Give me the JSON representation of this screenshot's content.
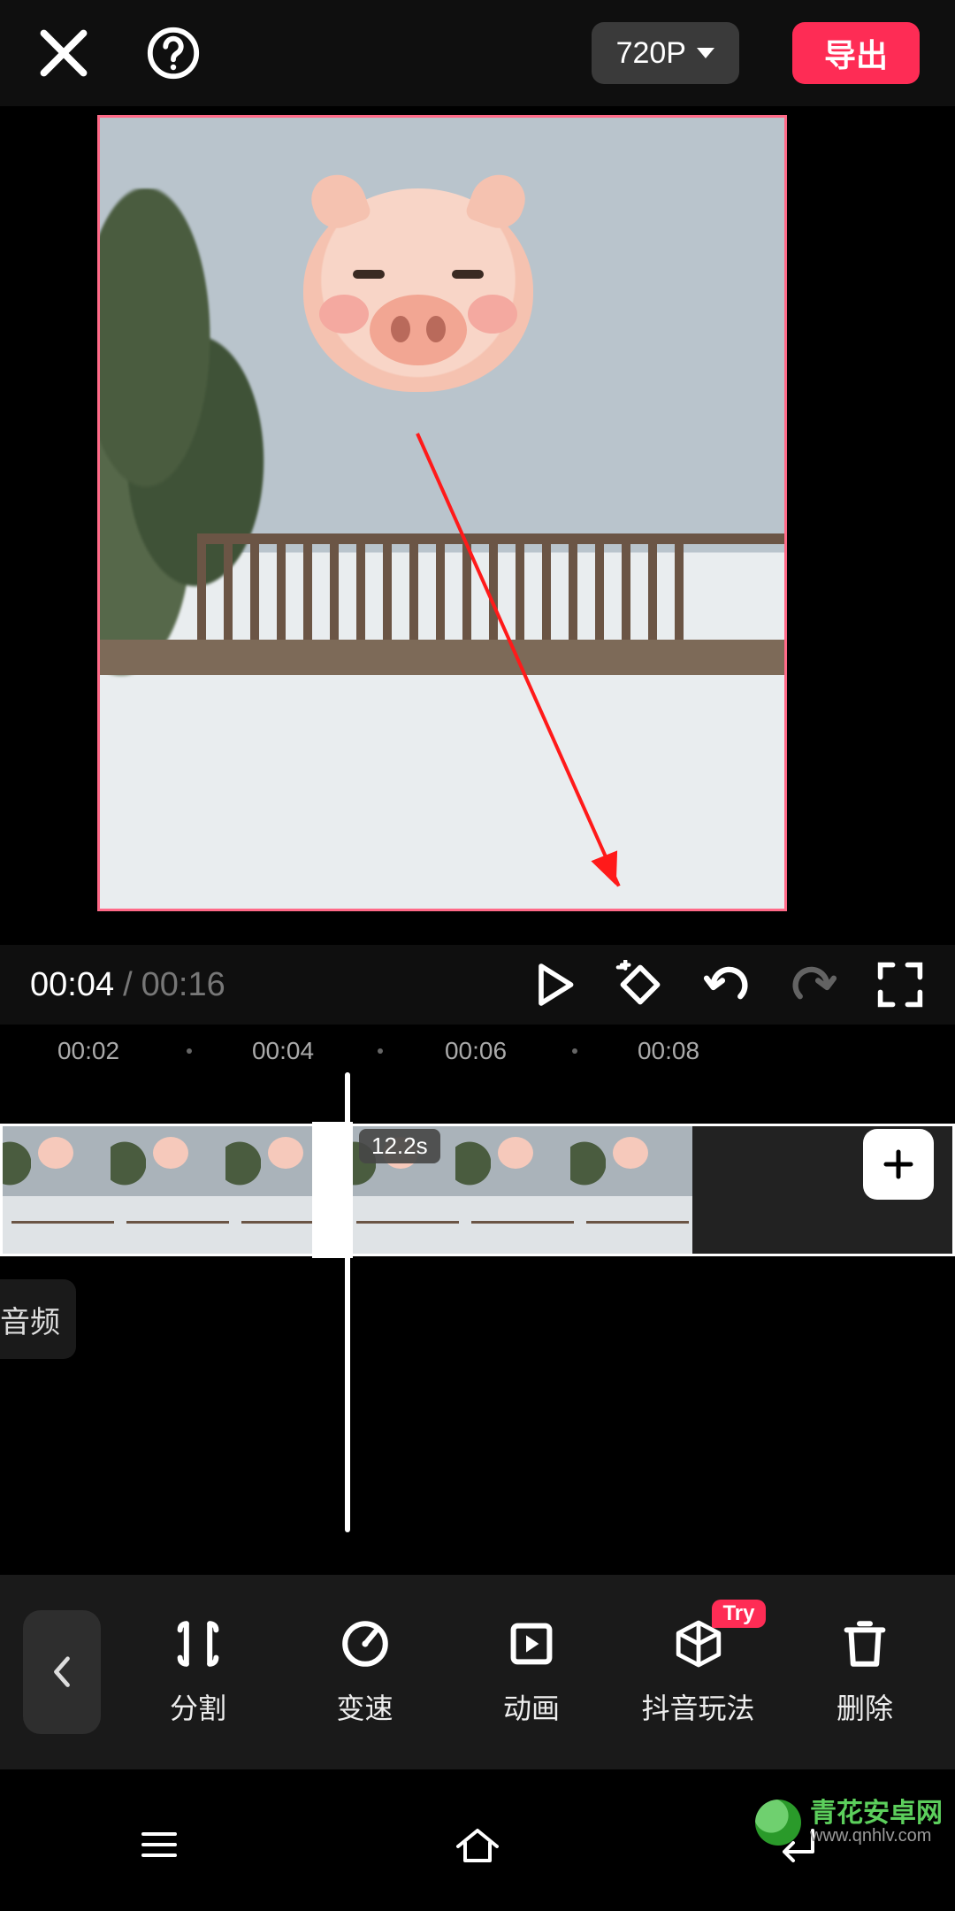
{
  "topbar": {
    "resolution_label": "720P",
    "export_label": "导出"
  },
  "playback": {
    "current_time": "00:04",
    "separator": "/",
    "duration": "00:16"
  },
  "timeline": {
    "ticks": [
      "00:02",
      "00:04",
      "00:06",
      "00:08"
    ],
    "clip_duration_badge": "12.2s",
    "audio_label": "音频"
  },
  "toolbar": {
    "items": [
      {
        "label": "分割",
        "icon": "split-icon"
      },
      {
        "label": "变速",
        "icon": "speed-icon"
      },
      {
        "label": "动画",
        "icon": "animation-icon"
      },
      {
        "label": "抖音玩法",
        "icon": "cube-icon",
        "badge": "Try"
      },
      {
        "label": "删除",
        "icon": "trash-icon"
      }
    ]
  },
  "watermark": {
    "line1": "青花安卓网",
    "line2": "www.qnhlv.com"
  },
  "colors": {
    "accent": "#fe2c55",
    "preview_border": "#ff6a88"
  }
}
